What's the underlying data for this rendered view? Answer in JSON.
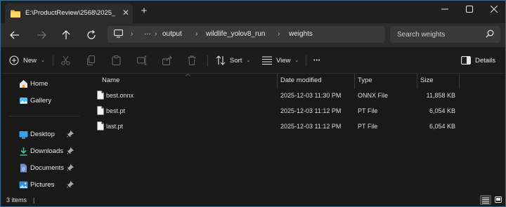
{
  "window": {
    "tab_title": "E:\\ProductReview\\2568\\2025_",
    "new_tab_symbol": "+"
  },
  "nav": {
    "breadcrumb": [
      "output",
      "wildlife_yolov8_run",
      "weights"
    ],
    "overflow": "···",
    "search_placeholder": "Search weights"
  },
  "commands": {
    "new_label": "New",
    "sort_label": "Sort",
    "view_label": "View",
    "details_label": "Details",
    "more_label": "•••"
  },
  "sidebar": {
    "items": [
      {
        "label": "Home",
        "icon": "home-icon",
        "pinned": false
      },
      {
        "label": "Gallery",
        "icon": "gallery-icon",
        "pinned": false
      },
      {
        "label": "Desktop",
        "icon": "desktop-icon",
        "pinned": true
      },
      {
        "label": "Downloads",
        "icon": "downloads-icon",
        "pinned": true
      },
      {
        "label": "Documents",
        "icon": "documents-icon",
        "pinned": true
      },
      {
        "label": "Pictures",
        "icon": "pictures-icon",
        "pinned": true
      }
    ]
  },
  "columns": {
    "name": "Name",
    "date": "Date modified",
    "type": "Type",
    "size": "Size"
  },
  "files": [
    {
      "name": "best.onnx",
      "date": "2025-12-03 11:30 PM",
      "type": "ONNX File",
      "size": "11,858 KB"
    },
    {
      "name": "best.pt",
      "date": "2025-12-03 11:12 PM",
      "type": "PT File",
      "size": "6,054 KB"
    },
    {
      "name": "last.pt",
      "date": "2025-12-03 11:12 PM",
      "type": "PT File",
      "size": "6,054 KB"
    }
  ],
  "status": {
    "item_count": "3 items",
    "separator": "|"
  },
  "colors": {
    "accent": "#4cc2ff",
    "folder": "#f5c244",
    "window_border": "#3a6f8e"
  }
}
